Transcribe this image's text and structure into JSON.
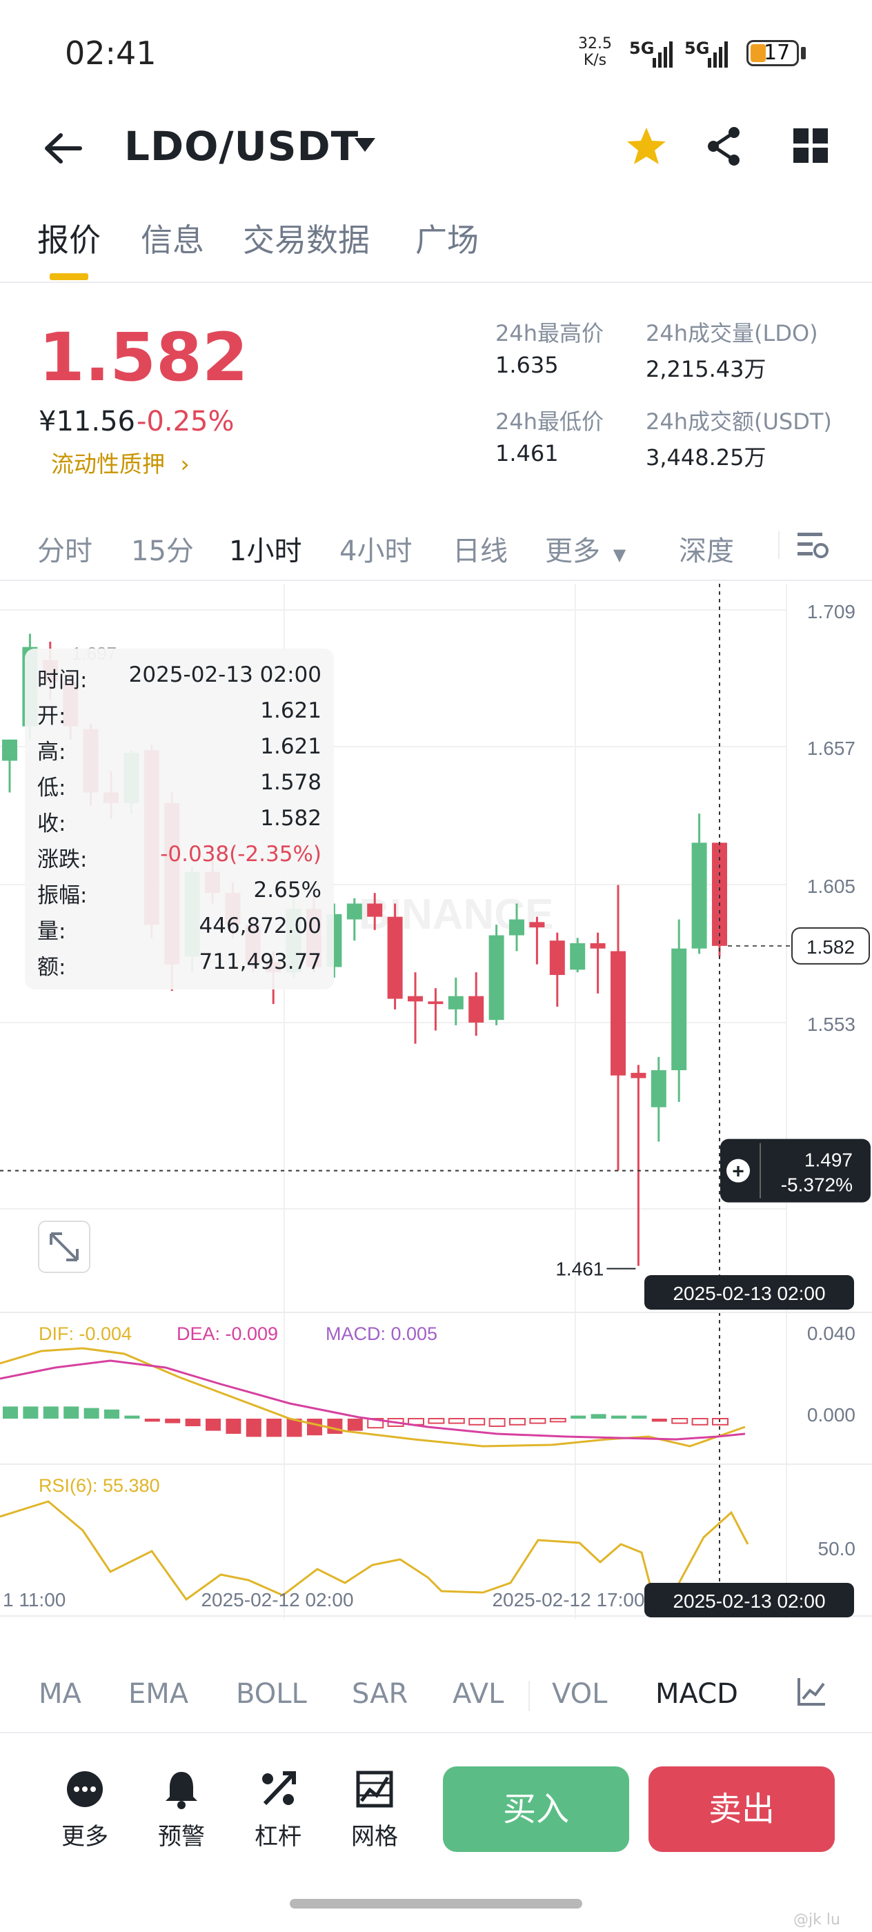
{
  "status_bar": {
    "time": "02:41",
    "net_speed_value": "32.5",
    "net_speed_unit": "K/s",
    "signal1": "5G",
    "signal2": "5G",
    "battery": "17"
  },
  "header": {
    "pair": "LDO/USDT",
    "icons": [
      "back-arrow-icon",
      "caret-down-icon",
      "star-icon",
      "share-icon",
      "grid-icon"
    ]
  },
  "tabs": [
    "报价",
    "信息",
    "交易数据",
    "广场"
  ],
  "ticker": {
    "price": "1.582",
    "cny": "¥11.56",
    "change_pct": "-0.25%",
    "stake_link": "流动性质押",
    "high_label": "24h最高价",
    "high": "1.635",
    "low_label": "24h最低价",
    "low": "1.461",
    "vol_label": "24h成交量(LDO)",
    "vol": "2,215.43万",
    "amount_label": "24h成交额(USDT)",
    "amount": "3,448.25万"
  },
  "intervals": [
    "分时",
    "15分",
    "1小时",
    "4小时",
    "日线",
    "更多",
    "深度"
  ],
  "active_interval": "1小时",
  "tooltip": {
    "time_label": "时间:",
    "time": "2025-02-13 02:00",
    "open_label": "开:",
    "open": "1.621",
    "high_label": "高:",
    "high": "1.621",
    "low_label": "低:",
    "low": "1.578",
    "close_label": "收:",
    "close": "1.582",
    "change_label": "涨跌:",
    "change": "-0.038(-2.35%)",
    "amp_label": "振幅:",
    "amp": "2.65%",
    "vol_label": "量:",
    "vol": "446,872.00",
    "amount_label": "额:",
    "amount": "711,493.77"
  },
  "chart_data": {
    "type": "candlestick",
    "price_axis": [
      "1.709",
      "1.657",
      "1.605",
      "1.553"
    ],
    "ylim": [
      1.461,
      1.709
    ],
    "current_price_tag": "1.582",
    "crosshair_price": "1.497",
    "crosshair_pct": "-5.372%",
    "min_label": "1.461",
    "max_label": "1.697",
    "crosshair_time": "2025-02-13 02:00",
    "x_labels": [
      "1 11:00",
      "2025-02-12 02:00",
      "2025-02-12 17:00"
    ],
    "watermark": "BINANCE",
    "candles": [
      {
        "o": 1.652,
        "h": 1.66,
        "l": 1.64,
        "c": 1.66
      },
      {
        "o": 1.665,
        "h": 1.7,
        "l": 1.66,
        "c": 1.695
      },
      {
        "o": 1.69,
        "h": 1.697,
        "l": 1.675,
        "c": 1.682
      },
      {
        "o": 1.682,
        "h": 1.686,
        "l": 1.66,
        "c": 1.665
      },
      {
        "o": 1.664,
        "h": 1.666,
        "l": 1.635,
        "c": 1.64
      },
      {
        "o": 1.64,
        "h": 1.648,
        "l": 1.63,
        "c": 1.636
      },
      {
        "o": 1.636,
        "h": 1.656,
        "l": 1.632,
        "c": 1.655
      },
      {
        "o": 1.656,
        "h": 1.658,
        "l": 1.585,
        "c": 1.59
      },
      {
        "o": 1.636,
        "h": 1.64,
        "l": 1.565,
        "c": 1.575
      },
      {
        "o": 1.578,
        "h": 1.612,
        "l": 1.572,
        "c": 1.61
      },
      {
        "o": 1.61,
        "h": 1.615,
        "l": 1.598,
        "c": 1.602
      },
      {
        "o": 1.602,
        "h": 1.606,
        "l": 1.585,
        "c": 1.59
      },
      {
        "o": 1.59,
        "h": 1.592,
        "l": 1.572,
        "c": 1.575
      },
      {
        "o": 1.576,
        "h": 1.58,
        "l": 1.56,
        "c": 1.572
      },
      {
        "o": 1.572,
        "h": 1.6,
        "l": 1.57,
        "c": 1.596
      },
      {
        "o": 1.596,
        "h": 1.606,
        "l": 1.572,
        "c": 1.574
      },
      {
        "o": 1.574,
        "h": 1.598,
        "l": 1.57,
        "c": 1.594
      },
      {
        "o": 1.592,
        "h": 1.6,
        "l": 1.584,
        "c": 1.598
      },
      {
        "o": 1.598,
        "h": 1.602,
        "l": 1.588,
        "c": 1.593
      },
      {
        "o": 1.593,
        "h": 1.598,
        "l": 1.558,
        "c": 1.562
      },
      {
        "o": 1.563,
        "h": 1.572,
        "l": 1.545,
        "c": 1.561
      },
      {
        "o": 1.561,
        "h": 1.566,
        "l": 1.55,
        "c": 1.56
      },
      {
        "o": 1.558,
        "h": 1.57,
        "l": 1.552,
        "c": 1.563
      },
      {
        "o": 1.563,
        "h": 1.572,
        "l": 1.548,
        "c": 1.553
      },
      {
        "o": 1.554,
        "h": 1.59,
        "l": 1.552,
        "c": 1.586
      },
      {
        "o": 1.586,
        "h": 1.598,
        "l": 1.58,
        "c": 1.592
      },
      {
        "o": 1.591,
        "h": 1.593,
        "l": 1.575,
        "c": 1.589
      },
      {
        "o": 1.584,
        "h": 1.587,
        "l": 1.559,
        "c": 1.571
      },
      {
        "o": 1.573,
        "h": 1.585,
        "l": 1.572,
        "c": 1.583
      },
      {
        "o": 1.583,
        "h": 1.587,
        "l": 1.564,
        "c": 1.581
      },
      {
        "o": 1.58,
        "h": 1.605,
        "l": 1.497,
        "c": 1.533
      },
      {
        "o": 1.534,
        "h": 1.537,
        "l": 1.461,
        "c": 1.532
      },
      {
        "o": 1.521,
        "h": 1.54,
        "l": 1.508,
        "c": 1.535
      },
      {
        "o": 1.535,
        "h": 1.592,
        "l": 1.523,
        "c": 1.581
      },
      {
        "o": 1.581,
        "h": 1.632,
        "l": 1.579,
        "c": 1.621
      },
      {
        "o": 1.621,
        "h": 1.621,
        "l": 1.578,
        "c": 1.582
      }
    ],
    "macd": {
      "dif_label": "DIF: -0.004",
      "dea_label": "DEA: -0.009",
      "macd_label": "MACD: 0.005",
      "axis": [
        "0.040",
        "0.000"
      ]
    },
    "rsi": {
      "label": "RSI(6): 55.380",
      "axis": [
        "50.0"
      ]
    }
  },
  "indicators": [
    "MA",
    "EMA",
    "BOLL",
    "SAR",
    "AVL",
    "VOL",
    "MACD"
  ],
  "active_indicator": "MACD",
  "actions": [
    "更多",
    "预警",
    "杠杆",
    "网格"
  ],
  "buy": "买入",
  "sell": "卖出",
  "watermark_corner": "@jk lu",
  "colors": {
    "up": "#5bbd85",
    "down": "#e0485a",
    "accent": "#f0b90b"
  }
}
